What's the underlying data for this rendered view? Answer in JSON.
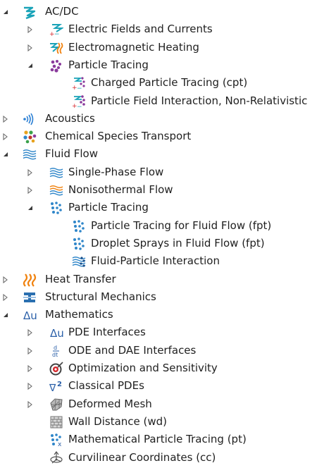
{
  "tree": {
    "items": [
      {
        "label": "AC/DC",
        "level": 0,
        "state": "expanded",
        "icon": "acdc-icon"
      },
      {
        "label": "Electric Fields and Currents",
        "level": 1,
        "state": "collapsed",
        "icon": "electric-fields-icon"
      },
      {
        "label": "Electromagnetic Heating",
        "level": 1,
        "state": "collapsed",
        "icon": "electromagnetic-heating-icon"
      },
      {
        "label": "Particle Tracing",
        "level": 1,
        "state": "expanded",
        "icon": "particle-tracing-icon"
      },
      {
        "label": "Charged Particle Tracing (cpt)",
        "level": 2,
        "state": "leaf",
        "icon": "charged-particle-icon"
      },
      {
        "label": "Particle Field Interaction, Non-Relativistic",
        "level": 2,
        "state": "leaf",
        "icon": "particle-field-interaction-icon"
      },
      {
        "label": "Acoustics",
        "level": 0,
        "state": "collapsed",
        "icon": "acoustics-icon"
      },
      {
        "label": "Chemical Species Transport",
        "level": 0,
        "state": "collapsed",
        "icon": "chemical-species-icon"
      },
      {
        "label": "Fluid Flow",
        "level": 0,
        "state": "expanded",
        "icon": "fluid-flow-icon"
      },
      {
        "label": "Single-Phase Flow",
        "level": 1,
        "state": "collapsed",
        "icon": "single-phase-flow-icon"
      },
      {
        "label": "Nonisothermal Flow",
        "level": 1,
        "state": "collapsed",
        "icon": "nonisothermal-flow-icon"
      },
      {
        "label": "Particle Tracing",
        "level": 1,
        "state": "expanded",
        "icon": "fluid-particle-tracing-icon"
      },
      {
        "label": "Particle Tracing for Fluid Flow (fpt)",
        "level": 2,
        "state": "leaf",
        "icon": "fluid-particle-tracing-icon"
      },
      {
        "label": "Droplet Sprays in Fluid Flow (fpt)",
        "level": 2,
        "state": "leaf",
        "icon": "droplet-sprays-icon"
      },
      {
        "label": "Fluid-Particle Interaction",
        "level": 2,
        "state": "leaf",
        "icon": "fluid-particle-interaction-icon"
      },
      {
        "label": "Heat Transfer",
        "level": 0,
        "state": "collapsed",
        "icon": "heat-transfer-icon"
      },
      {
        "label": "Structural Mechanics",
        "level": 0,
        "state": "collapsed",
        "icon": "structural-mechanics-icon"
      },
      {
        "label": "Mathematics",
        "level": 0,
        "state": "expanded",
        "icon": "mathematics-icon"
      },
      {
        "label": "PDE Interfaces",
        "level": 1,
        "state": "collapsed",
        "icon": "pde-interfaces-icon"
      },
      {
        "label": "ODE and DAE Interfaces",
        "level": 1,
        "state": "collapsed",
        "icon": "ode-dae-icon"
      },
      {
        "label": "Optimization and Sensitivity",
        "level": 1,
        "state": "collapsed",
        "icon": "optimization-icon"
      },
      {
        "label": "Classical PDEs",
        "level": 1,
        "state": "collapsed",
        "icon": "classical-pdes-icon"
      },
      {
        "label": "Deformed Mesh",
        "level": 1,
        "state": "collapsed",
        "icon": "deformed-mesh-icon"
      },
      {
        "label": "Wall Distance (wd)",
        "level": 1,
        "state": "leaf",
        "icon": "wall-distance-icon"
      },
      {
        "label": "Mathematical Particle Tracing (pt)",
        "level": 1,
        "state": "leaf",
        "icon": "math-particle-tracing-icon"
      },
      {
        "label": "Curvilinear Coordinates (cc)",
        "level": 1,
        "state": "leaf",
        "icon": "curvilinear-coordinates-icon"
      }
    ]
  },
  "colors": {
    "text": "#1f1f1f",
    "twisty": "#6b6b6b",
    "acdc": "#1aa3b8",
    "particle": "#8a3a9c",
    "acoustics": "#2a7fd4",
    "fluid": "#2f86c9",
    "heat": "#f0820f",
    "structural": "#2a6fb0",
    "math": "#2a5fa8",
    "red": "#d4262b"
  }
}
